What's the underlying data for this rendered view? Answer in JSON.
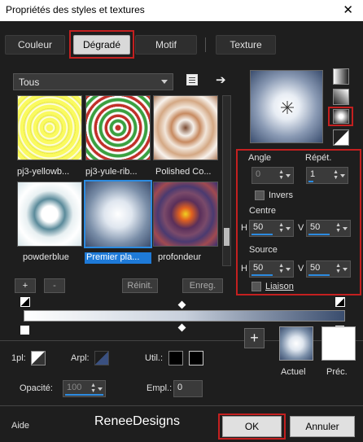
{
  "window": {
    "title": "Propriétés des styles et textures",
    "close": "✕"
  },
  "tabs": [
    {
      "label": "Couleur"
    },
    {
      "label": "Dégradé"
    },
    {
      "label": "Motif"
    },
    {
      "label": "Texture"
    }
  ],
  "category": {
    "selected": "Tous"
  },
  "thumbnails": [
    {
      "label": "pj3-yellowb..."
    },
    {
      "label": "pj3-yule-rib..."
    },
    {
      "label": "Polished Co..."
    },
    {
      "label": "powderblue"
    },
    {
      "label": "Premier pla..."
    },
    {
      "label": "profondeur"
    }
  ],
  "gradient_buttons": {
    "add": "+",
    "remove": "-",
    "reset": "Réinit.",
    "save": "Enreg."
  },
  "params": {
    "angle_label": "Angle",
    "angle_value": "0",
    "repeat_label": "Répét.",
    "repeat_value": "1",
    "invert_label": "Invers",
    "center_label": "Centre",
    "center_h": "50",
    "center_v": "50",
    "source_label": "Source",
    "source_h": "50",
    "source_v": "50",
    "h_label": "H",
    "v_label": "V",
    "link_label": "Liaison"
  },
  "bottom": {
    "plus_label": "1pl:",
    "arpl_label": "Arpl:",
    "util_label": "Util.:",
    "opacity_label": "Opacité:",
    "opacity_value": "100",
    "empl_label": "Empl.:",
    "empl_value": "0",
    "current_label": "Actuel",
    "previous_label": "Préc.",
    "plus_button": "+"
  },
  "footer": {
    "help": "Aide",
    "watermark": "ReneeDesigns",
    "ok": "OK",
    "cancel": "Annuler"
  },
  "colors": {
    "accent": "#1e7ad8",
    "highlight": "#c42020",
    "gradient_start": "#ffffff",
    "gradient_end": "#3a4d6e"
  }
}
